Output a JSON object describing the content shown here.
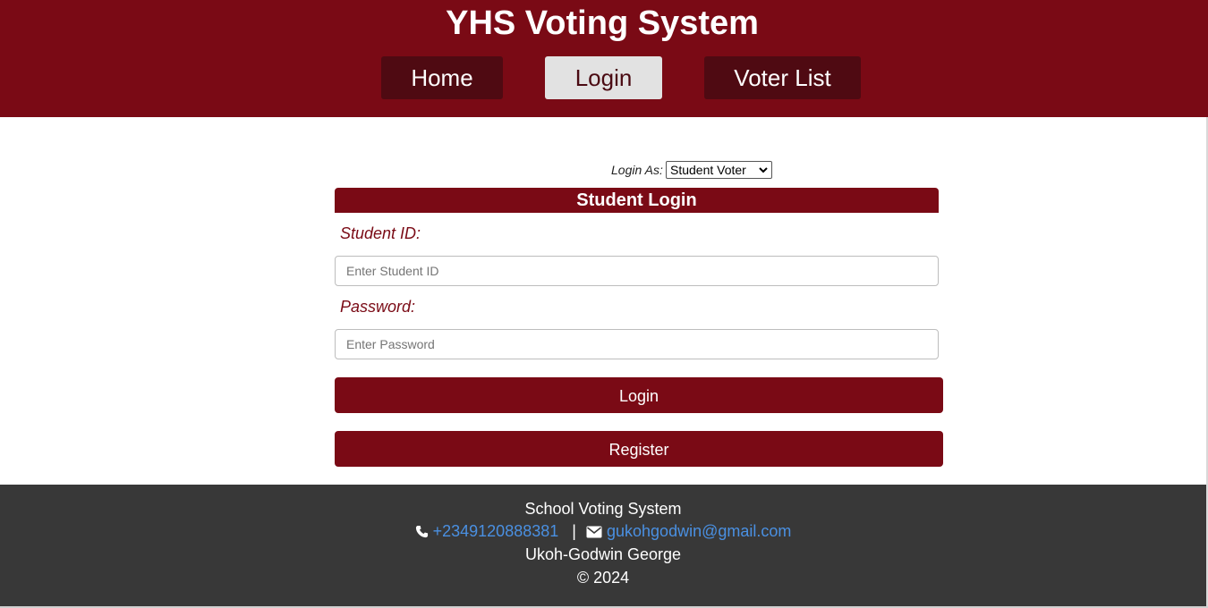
{
  "header": {
    "title": "YHS Voting System",
    "nav": [
      {
        "label": "Home"
      },
      {
        "label": "Login"
      },
      {
        "label": "Voter List"
      }
    ]
  },
  "login_as": {
    "label": "Login As:",
    "selected": "Student Voter"
  },
  "form": {
    "title": "Student Login",
    "id_label": "Student ID:",
    "id_placeholder": "Enter Student ID",
    "password_label": "Password:",
    "password_placeholder": "Enter Password",
    "login_label": "Login",
    "register_label": "Register"
  },
  "footer": {
    "name": "School Voting System",
    "phone": "+2349120888381",
    "separator": "|",
    "email": "gukohgodwin@gmail.com",
    "author": "Ukoh-Godwin George",
    "copyright": "© 2024"
  },
  "colors": {
    "brand": "#7a0a15",
    "nav_button": "#4f0a12",
    "nav_active": "#e2e2e2",
    "footer_bg": "#383838",
    "link": "#4a90e2"
  },
  "icons": [
    "phone-icon",
    "envelope-icon",
    "chevron-down-icon"
  ]
}
